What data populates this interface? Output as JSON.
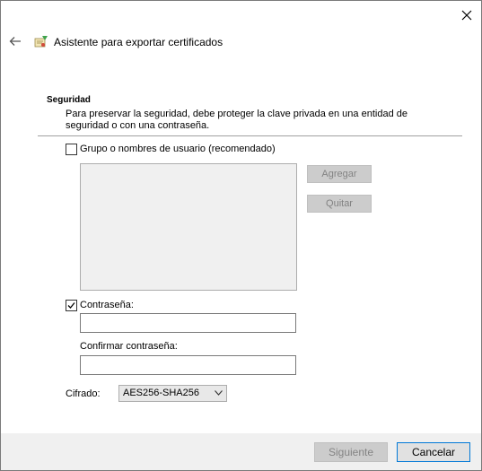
{
  "window": {
    "title": "Asistente para exportar certificados"
  },
  "section": {
    "heading": "Seguridad",
    "description": "Para preservar la seguridad, debe proteger la clave privada en una entidad de seguridad o con una contraseña."
  },
  "group": {
    "checkbox_label": "Grupo o nombres de usuario (recomendado)",
    "checked": false,
    "add_label": "Agregar",
    "remove_label": "Quitar"
  },
  "password": {
    "checkbox_label": "Contraseña:",
    "checked": true,
    "value": "",
    "confirm_label": "Confirmar contraseña:",
    "confirm_value": ""
  },
  "encryption": {
    "label": "Cifrado:",
    "selected": "AES256-SHA256"
  },
  "footer": {
    "next_label": "Siguiente",
    "cancel_label": "Cancelar"
  },
  "colors": {
    "accent": "#0078d7",
    "disabled_bg": "#cccccc",
    "disabled_text": "#838383"
  },
  "icons": [
    "close-icon",
    "back-arrow-icon",
    "certificate-wizard-icon",
    "checkmark-icon",
    "chevron-down-icon"
  ]
}
